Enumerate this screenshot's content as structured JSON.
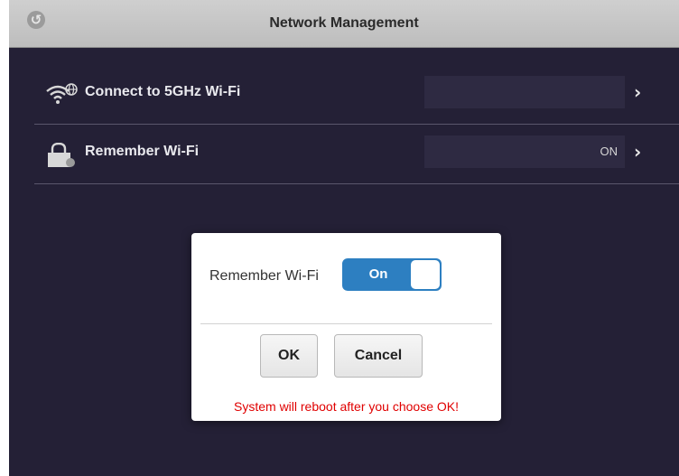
{
  "header": {
    "title": "Network Management",
    "back_icon": "back-arrow-icon"
  },
  "settings": [
    {
      "label": "Connect to 5GHz Wi-Fi",
      "value": "",
      "icon": "wifi-globe-icon"
    },
    {
      "label": "Remember Wi-Fi",
      "value": "ON",
      "icon": "lock-wifi-icon"
    }
  ],
  "dialog": {
    "label": "Remember Wi-Fi",
    "toggle_text": "On",
    "ok_label": "OK",
    "cancel_label": "Cancel",
    "warning": "System will reboot after you choose OK!"
  },
  "colors": {
    "background": "#242036",
    "accent": "#2d7fc1",
    "warning": "#e00000"
  }
}
